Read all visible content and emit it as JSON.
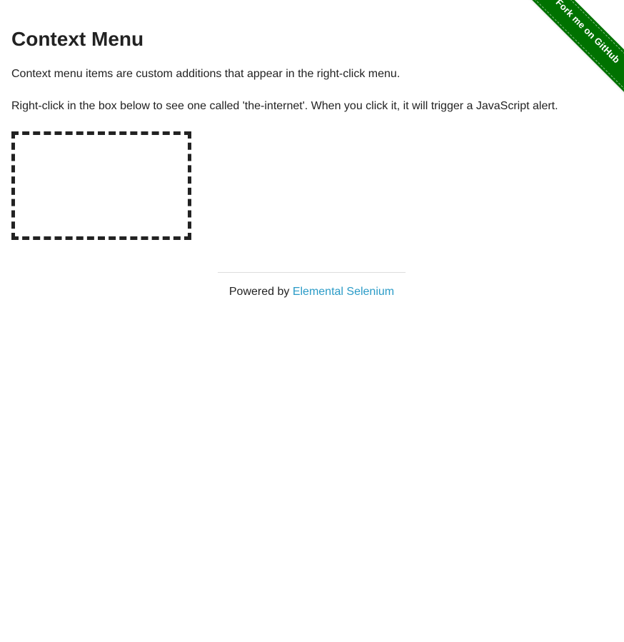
{
  "ribbon": {
    "label": "Fork me on GitHub",
    "color": "#007200"
  },
  "page": {
    "title": "Context Menu",
    "paragraphs": [
      "Context menu items are custom additions that appear in the right-click menu.",
      "Right-click in the box below to see one called 'the-internet'. When you click it, it will trigger a JavaScript alert."
    ]
  },
  "footer": {
    "prefix": "Powered by ",
    "link_label": "Elemental Selenium",
    "link_color": "#2a9bc7"
  }
}
